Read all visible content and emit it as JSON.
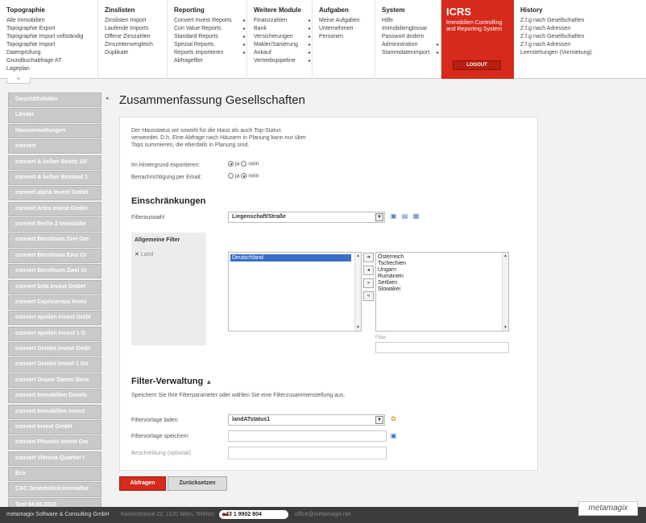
{
  "topnav": {
    "columns": [
      {
        "title": "Topographie",
        "items": [
          "Alle Immobilien",
          "Topographie Export",
          "Topographie Import vollständig",
          "Topographie Import",
          "Datenprüfung",
          "Grundbuchabfrage AT",
          "Lageplan"
        ]
      },
      {
        "title": "Zinslisten",
        "items": [
          "Zinslisten Import",
          "Laufende Imports",
          "Offene Zinszahlen",
          "Zinszeitenvergleich",
          "Duplikate"
        ]
      },
      {
        "title": "Reporting",
        "items": [
          "Convert Invest Reports",
          "Con Value Reports",
          "Standard Reports",
          "Spezial Reports",
          "Reports importieren",
          "Abfrageflter"
        ]
      },
      {
        "title": "Weitere Module",
        "items": [
          "Finanzzahlen",
          "Bank",
          "Versicherungen",
          "Makler/Sanierung",
          "Ankauf",
          "Vertriebspipeline"
        ]
      },
      {
        "title": "Aufgaben",
        "items": [
          "Meine Aufgaben",
          "Unternehmen",
          "Personen"
        ]
      },
      {
        "title": "System",
        "items": [
          "Hilfe",
          "Immobilienglossar",
          "Passwort ändern",
          "Administration",
          "Stammdatenimport"
        ]
      },
      {
        "title": "History",
        "items": [
          "Z.f.g nach Gesellschaften",
          "Z.f.g nach Adressen",
          "Z.f.g nach Gesellschaften",
          "Z.f.g nach Adressen",
          "Leerstehungen (Vormietung)"
        ]
      }
    ],
    "icrs": {
      "title": "ICRS",
      "subtitle": "Immobilien Controlling and Reporting System",
      "logout": "LOGOUT"
    },
    "collapse": "+"
  },
  "sidebar": {
    "toggle": "◂",
    "items": [
      "Geschäftsfelder",
      "Länder",
      "Hausverwaltungen",
      "convert",
      "convert & kelber Besitz 10/",
      "convert & kelber Bestand 1",
      "convert alpha Invest GmbH",
      "convert Aries Invest GmbH",
      "convert Berlin 2 Immobilie",
      "convert Berolinum Drei Gm",
      "convert Berolinum Eins Gr",
      "convert Berolinum Zwei Gr",
      "convert beta Invest GmbH",
      "convert Capricornus Inves",
      "convert epsilon Invest GmbI",
      "convert epsilon Invest 1 G",
      "convert Gemini Invest GmbI",
      "convert Gemini Invest 1 Gn",
      "convert Grazer Damm Deve",
      "convert Immobilien Develo",
      "convert Immobilien Invest",
      "convert Invest GmbH",
      "convert Phoenix Invest Gm",
      "convert Viktoria Quartier I",
      "Eco",
      "CAC Grundstücksverwaltur",
      "Test 04.06.2010"
    ]
  },
  "main": {
    "title": "Zusammenfassung Gesellschaften",
    "description": [
      "Der Hausstatus wir sowohl für die Haus als auch Top-Status",
      "verwendet. D.h. Eine Abfrage nach Häusern in Planung kann nur über",
      "Tops summieren, die ebenfalls in Planung sind."
    ],
    "export_label": "Im Hintergrund exportieren:",
    "notify_label": "Benachrichtigung per Email:",
    "ja": "ja",
    "nein": "nein",
    "restrictions_heading": "Einschränkungen",
    "filter_choice_label": "Filterauswahl",
    "filter_choice_value": "Liegenschaft/Straße",
    "general_filter_label": "Allgemeine Filter",
    "land_label": "Land",
    "left_list": [
      "Deutschland"
    ],
    "right_list": [
      "Österreich",
      "Tschechien",
      "Ungarn",
      "Rumänien",
      "Serbien",
      "Slowakei"
    ],
    "filter_input_label": "Filter",
    "filter_admin_heading": "Filter-Verwaltung",
    "filter_admin_desc": "Speichern Sie Ihre Filterparameter oder wählen Sie eine Filterzusammenstellung aus.",
    "template_load_label": "Filtervorlage laden",
    "template_load_value": "landATstatus1",
    "template_save_label": "Filtervorlage speichern",
    "description_label": "Beschreibung (optional)"
  },
  "buttons": {
    "query": "Abfragen",
    "reset": "Zurücksetzen"
  },
  "footer": {
    "company": "metamagix Software & Consulting GmbH",
    "address": "Kaiserstrasse 22, 1120 Wien, Telefon:",
    "phone": "+43 1 9902 804",
    "email": "office@metamagix.net",
    "logo": "metamagix"
  }
}
